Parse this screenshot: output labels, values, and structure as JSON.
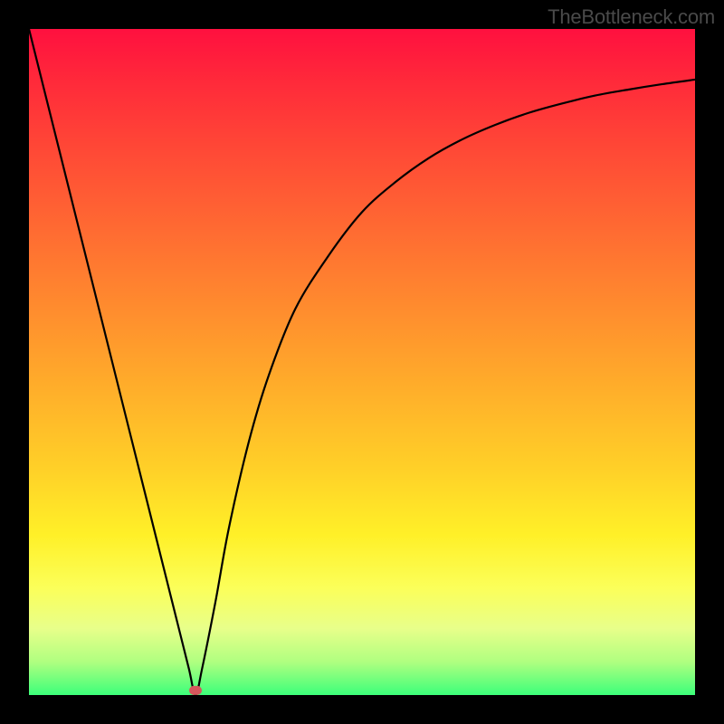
{
  "watermark": "TheBottleneck.com",
  "chart_data": {
    "type": "line",
    "title": "",
    "xlabel": "",
    "ylabel": "",
    "xlim": [
      0,
      100
    ],
    "ylim": [
      0,
      100
    ],
    "grid": false,
    "legend": false,
    "background_gradient": [
      "#ff103f",
      "#ffd028",
      "#3cff7a"
    ],
    "series": [
      {
        "name": "curve",
        "x": [
          0,
          5,
          10,
          15,
          20,
          22,
          24,
          25,
          26,
          28,
          30,
          33,
          36,
          40,
          45,
          50,
          55,
          60,
          65,
          70,
          75,
          80,
          85,
          90,
          95,
          100
        ],
        "values": [
          100,
          80,
          60,
          40,
          20,
          12,
          4,
          0,
          4,
          14,
          25,
          38,
          48,
          58,
          66,
          72.5,
          77,
          80.6,
          83.4,
          85.6,
          87.4,
          88.8,
          90,
          90.9,
          91.7,
          92.4
        ],
        "color": "#000000"
      }
    ],
    "markers": [
      {
        "name": "minimum-marker",
        "x": 25,
        "y": 0.7,
        "color": "#d6575c",
        "shape": "rounded-rect"
      }
    ]
  }
}
